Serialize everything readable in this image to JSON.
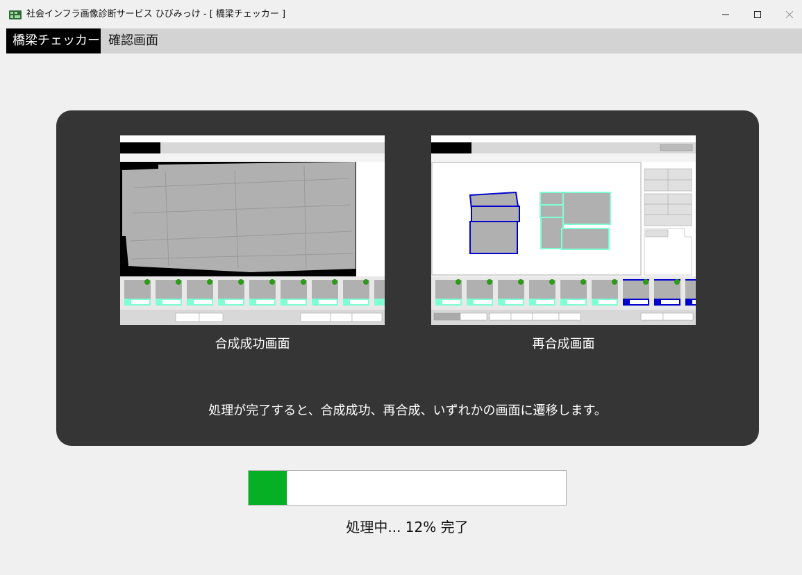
{
  "window": {
    "title": "社会インフラ画像診断サービス ひびみっけ - [ 橋梁チェッカー ]",
    "icons": {
      "app": "app-logo-icon",
      "minimize": "minimize-icon",
      "maximize": "maximize-icon",
      "close": "close-icon"
    }
  },
  "menu": {
    "active_tab": "橋梁チェッカー",
    "tab2": "確認画面"
  },
  "panel": {
    "left_caption": "合成成功画面",
    "right_caption": "再合成画面",
    "message": "処理が完了すると、合成成功、再合成、いずれかの画面に遷移します。"
  },
  "progress": {
    "percent": 12,
    "text": "処理中... 12% 完了",
    "fill_color": "#06b025"
  },
  "colors": {
    "panel_bg": "#353535",
    "accent_teal": "#7fffd4",
    "accent_blue": "#0000cc",
    "status_green": "#2e9a1a"
  }
}
